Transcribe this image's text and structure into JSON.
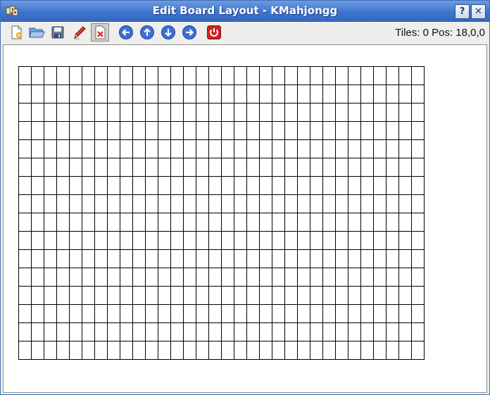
{
  "window": {
    "title": "Edit Board Layout - KMahjongg",
    "help_label": "?",
    "close_label": "✕"
  },
  "toolbar": {
    "tools": [
      {
        "name": "new-icon"
      },
      {
        "name": "open-icon"
      },
      {
        "name": "save-icon"
      },
      {
        "name": "pencil-icon"
      },
      {
        "name": "delete-icon",
        "active": true
      },
      {
        "name": "arrow-left-icon"
      },
      {
        "name": "arrow-up-icon"
      },
      {
        "name": "arrow-down-icon"
      },
      {
        "name": "arrow-right-icon"
      },
      {
        "name": "quit-icon"
      }
    ]
  },
  "status": {
    "text": "Tiles: 0 Pos: 18,0,0"
  },
  "board": {
    "columns": 32,
    "rows": 16,
    "line_color": "#000000"
  },
  "colors": {
    "titlebar": "#3f75cf",
    "arrow_blue": "#3b6fd4",
    "quit_red": "#d42020"
  }
}
